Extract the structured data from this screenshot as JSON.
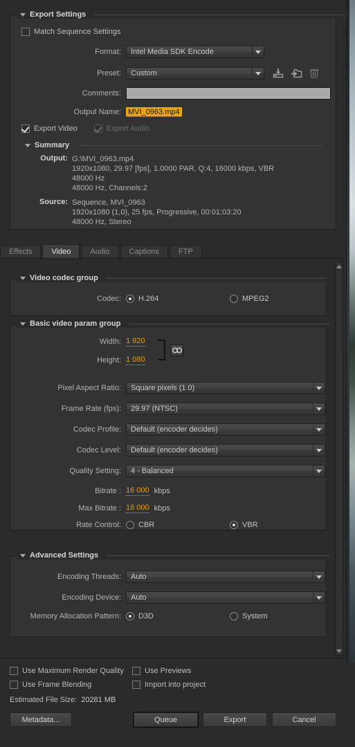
{
  "export_settings": {
    "title": "Export Settings",
    "match_sequence": {
      "label": "Match Sequence Settings",
      "checked": false
    },
    "format": {
      "label": "Format:",
      "value": "Intel Media SDK Encode"
    },
    "preset": {
      "label": "Preset:",
      "value": "Custom"
    },
    "preset_actions": [
      {
        "name": "save-preset-icon",
        "title": "Save Preset"
      },
      {
        "name": "import-preset-icon",
        "title": "Import Preset"
      },
      {
        "name": "delete-preset-icon",
        "title": "Delete Preset"
      }
    ],
    "comments": {
      "label": "Comments:",
      "value": "",
      "placeholder": ""
    },
    "output_name": {
      "label": "Output Name:",
      "value": "MVI_0963.mp4"
    },
    "export_video": {
      "label": "Export Video",
      "checked": true,
      "enabled": true
    },
    "export_audio": {
      "label": "Export Audio",
      "checked": true,
      "enabled": false
    }
  },
  "summary": {
    "title": "Summary",
    "output_key": "Output:",
    "output_lines": [
      "G:\\MVI_0963.mp4",
      "1920x1080, 29.97 [fps], 1.0000 PAR, Q:4, 16000 kbps, VBR",
      "48000 Hz",
      "48000 Hz, Channels:2"
    ],
    "source_key": "Source:",
    "source_lines": [
      "Sequence, MVI_0963",
      "1920x1080 (1,0), 25 fps, Progressive, 00:01:03:20",
      "48000 Hz, Stereo"
    ]
  },
  "tabs": [
    {
      "label": "Effects",
      "active": false
    },
    {
      "label": "Video",
      "active": true
    },
    {
      "label": "Audio",
      "active": false
    },
    {
      "label": "Captions",
      "active": false
    },
    {
      "label": "FTP",
      "active": false
    }
  ],
  "video_codec_group": {
    "title": "Video codec group",
    "codec_label": "Codec:",
    "options": [
      {
        "label": "H.264",
        "selected": true
      },
      {
        "label": "MPEG2",
        "selected": false
      }
    ]
  },
  "basic_video_param_group": {
    "title": "Basic video param group",
    "width": {
      "label": "Width:",
      "value": "1 920"
    },
    "height": {
      "label": "Height:",
      "value": "1 080"
    },
    "link_icon": "chain-link-icon",
    "pixel_aspect_ratio": {
      "label": "Pixel Aspect Ratio:",
      "value": "Square pixels (1.0)"
    },
    "frame_rate": {
      "label": "Frame Rate (fps):",
      "value": "29.97 (NTSC)"
    },
    "codec_profile": {
      "label": "Codec Profile:",
      "value": "Default (encoder decides)"
    },
    "codec_level": {
      "label": "Codec Level:",
      "value": "Default (encoder decides)"
    },
    "quality_setting": {
      "label": "Quality Setting:",
      "value": "4 - Balanced"
    },
    "bitrate": {
      "label": "Bitrate :",
      "value": "16 000",
      "unit": "kbps"
    },
    "max_bitrate": {
      "label": "Max Bitrate :",
      "value": "18 000",
      "unit": "kbps"
    },
    "rate_control": {
      "label": "Rate Control:",
      "options": [
        {
          "label": "CBR",
          "selected": false
        },
        {
          "label": "VBR",
          "selected": true
        }
      ]
    }
  },
  "advanced_settings": {
    "title": "Advanced Settings",
    "encoding_threads": {
      "label": "Encoding Threads:",
      "value": "Auto"
    },
    "encoding_device": {
      "label": "Encoding Device:",
      "value": "Auto"
    },
    "memory_allocation": {
      "label": "Memory Allocation Pattern:",
      "options": [
        {
          "label": "D3D",
          "selected": true
        },
        {
          "label": "System",
          "selected": false
        }
      ]
    }
  },
  "footer": {
    "checkboxes": [
      {
        "label": "Use Maximum Render Quality",
        "checked": false
      },
      {
        "label": "Use Previews",
        "checked": false
      },
      {
        "label": "Use Frame Blending",
        "checked": false
      },
      {
        "label": "Import into project",
        "checked": false
      }
    ],
    "estimated_label": "Estimated File Size:",
    "estimated_value": "20281 MB",
    "metadata_button": "Metadata...",
    "queue_button": "Queue",
    "export_button": "Export",
    "cancel_button": "Cancel"
  },
  "colors": {
    "accent_orange": "#e09a20",
    "highlight_amber": "#e8a317",
    "panel_bg": "#2b2b2b",
    "group_bg": "#333333"
  }
}
